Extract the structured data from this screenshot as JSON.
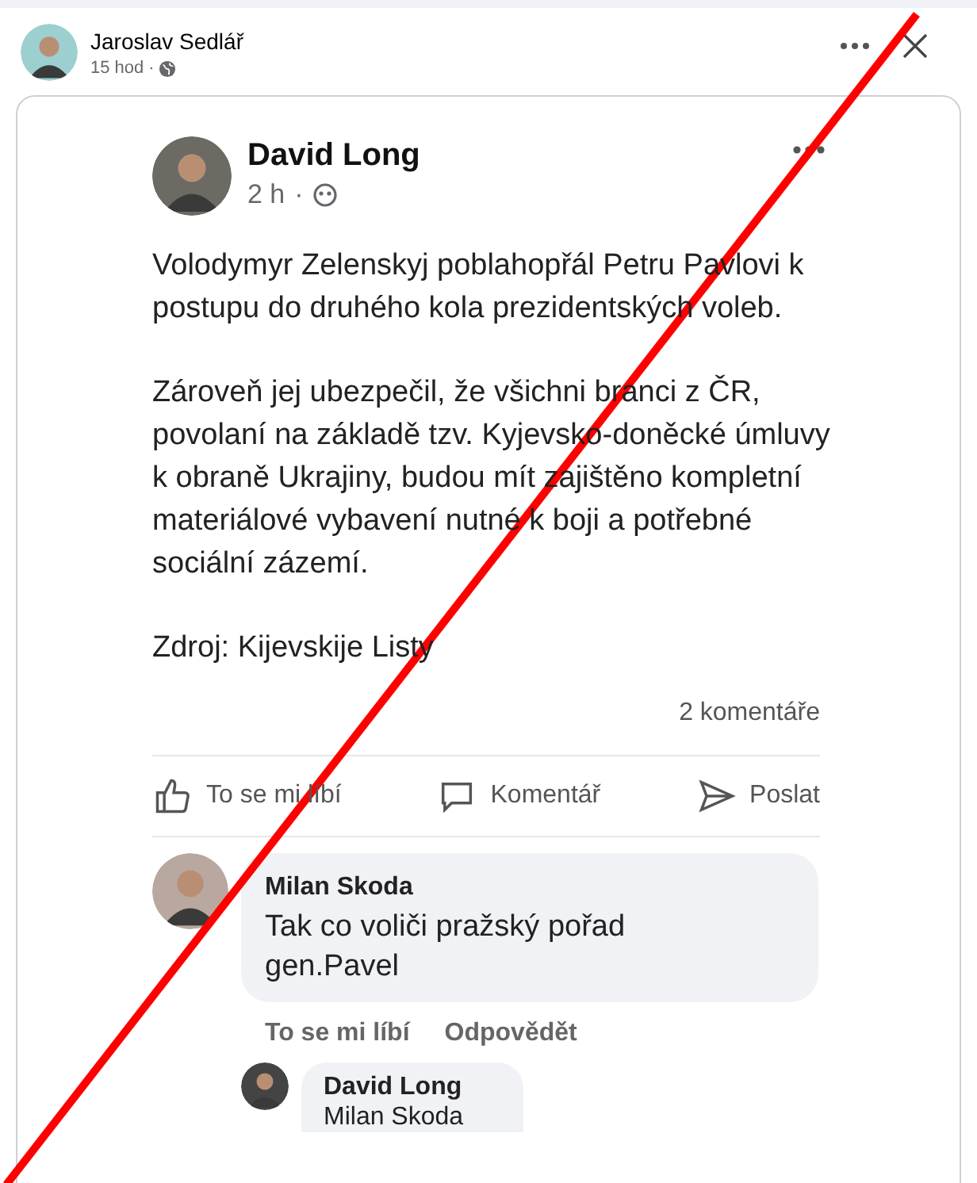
{
  "post": {
    "author": "Jaroslav Sedlář",
    "time": "15 hod",
    "separator": "·"
  },
  "shared_image": {
    "author": "David Long",
    "time": "2 h",
    "separator": "·",
    "paragraphs": [
      "Volodymyr Zelenskyj poblahopřál Petru Pavlovi k postupu do druhého kola prezidentských voleb.",
      "Zároveň jej ubezpečil, že všichni branci z ČR, povolaní na základě tzv. Kyjevsko-doněcké úmluvy k obraně Ukrajiny, budou mít zajištěno kompletní materiálové vybavení nutné k boji a potřebné sociální zázemí.",
      "Zdroj: Kijevskije Listy"
    ],
    "comment_count": "2 komentáře",
    "actions": [
      {
        "kind": "like",
        "label": "To se mi líbí"
      },
      {
        "kind": "comment",
        "label": "Komentář"
      },
      {
        "kind": "share",
        "label": "Poslat"
      }
    ],
    "comment": {
      "author": "Milan Skoda",
      "text": "Tak co voliči pražský pořad gen.Pavel",
      "actions": [
        "To se mi líbí",
        "Odpovědět"
      ]
    },
    "reply": {
      "author": "David Long",
      "text": "Milan Skoda"
    }
  }
}
